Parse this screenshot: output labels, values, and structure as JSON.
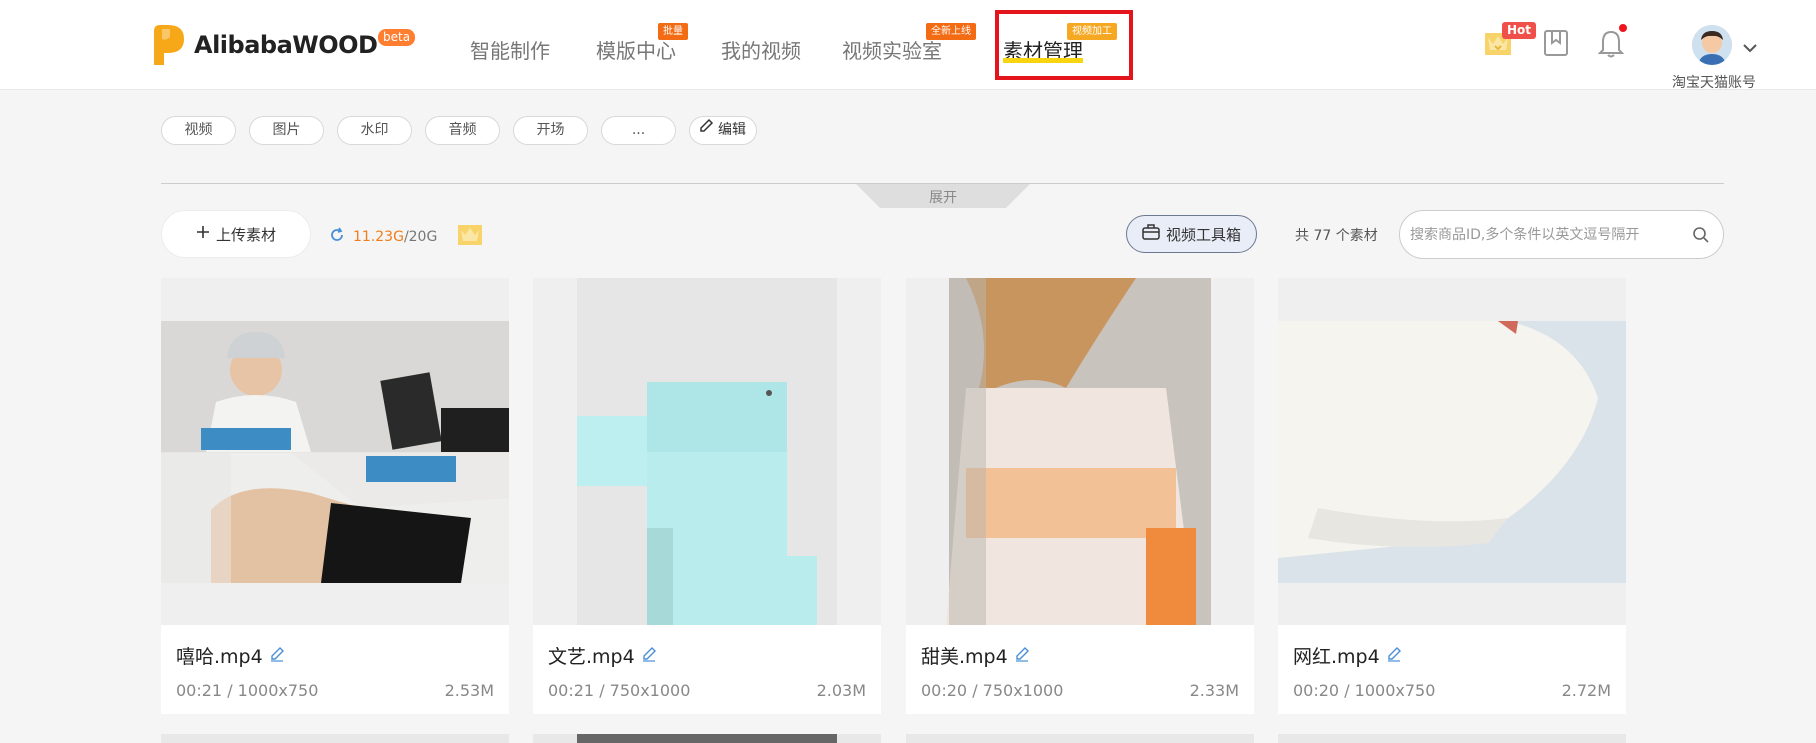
{
  "header": {
    "logo_text": "AlibabaWOOD",
    "beta_label": "beta",
    "nav": [
      {
        "label": "智能制作"
      },
      {
        "label": "模版中心",
        "badge": "批量"
      },
      {
        "label": "我的视频"
      },
      {
        "label": "视频实验室",
        "badge": "全新上线"
      },
      {
        "label": "素材管理",
        "badge": "视频加工",
        "active": true
      }
    ],
    "hot_label": "Hot",
    "account_name": "淘宝天猫账号"
  },
  "filters": {
    "tags": [
      "视频",
      "图片",
      "水印",
      "音频",
      "开场",
      "..."
    ],
    "edit_label": "编辑",
    "expand_label": "展开"
  },
  "toolbar": {
    "upload_label": "上传素材",
    "storage_used": "11.23G",
    "storage_total": "/20G",
    "toolbox_label": "视频工具箱",
    "count_text": "共 77 个素材",
    "search_placeholder": "搜索商品ID,多个条件以英文逗号隔开"
  },
  "cards": [
    {
      "title": "嘻哈.mp4",
      "meta": "00:21 / 1000x750",
      "size": "2.53M"
    },
    {
      "title": "文艺.mp4",
      "meta": "00:21 / 750x1000",
      "size": "2.03M"
    },
    {
      "title": "甜美.mp4",
      "meta": "00:20 / 750x1000",
      "size": "2.33M"
    },
    {
      "title": "网红.mp4",
      "meta": "00:20 / 1000x750",
      "size": "2.72M"
    }
  ],
  "colors": {
    "accent_orange": "#f36b13",
    "active_underline": "#f7d511",
    "highlight_box": "#e3141b",
    "storage_used": "#f07d1a"
  }
}
